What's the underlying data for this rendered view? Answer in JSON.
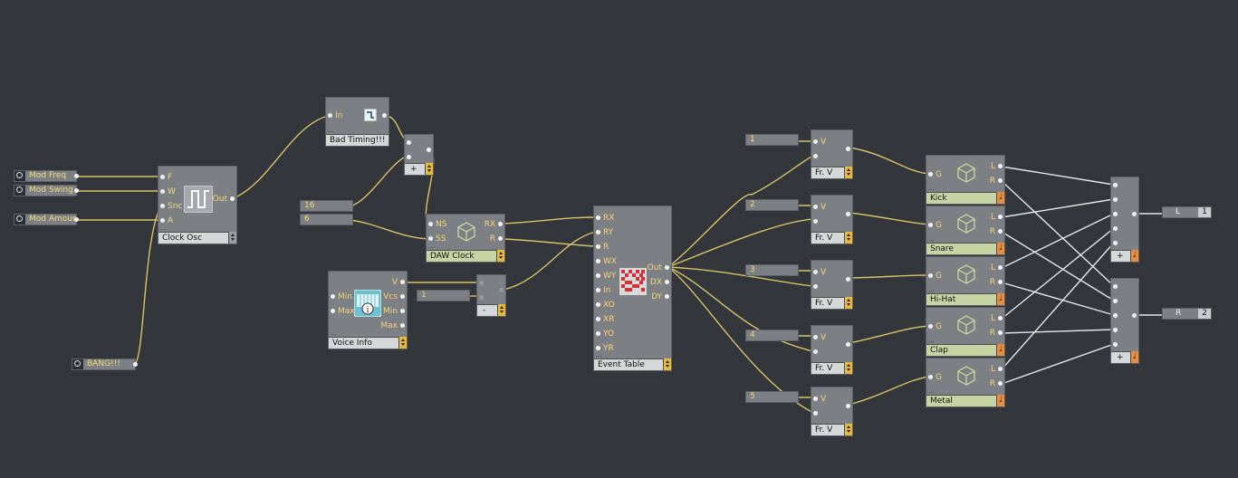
{
  "knobs": [
    {
      "label": "Mod Freq"
    },
    {
      "label": "Mod Swing"
    },
    {
      "label": "Mod Amount"
    }
  ],
  "bang": {
    "label": "BANG!!!"
  },
  "clock_osc": {
    "title": "Clock Osc",
    "in": [
      "F",
      "W",
      "Snc",
      "A"
    ],
    "out": "Out"
  },
  "bad_timing": {
    "title": "Bad Timing!!!",
    "in": "In"
  },
  "adder_top": {
    "title": "+"
  },
  "const_16": "16",
  "const_6": "6",
  "daw_clock": {
    "title": "DAW Clock",
    "in": [
      "NS",
      "SS"
    ],
    "out": [
      "RX",
      "R"
    ]
  },
  "voice_info": {
    "title": "Voice Info",
    "in": [
      "Min",
      "Max"
    ],
    "out": [
      "V",
      "Vcs",
      "Min",
      "Max"
    ]
  },
  "const_1": "1",
  "sub": {
    "title": "-"
  },
  "event_table": {
    "title": "Event Table",
    "in": [
      "RX",
      "RY",
      "R",
      "WX",
      "WY",
      "In",
      "XO",
      "XR",
      "YO",
      "YR"
    ],
    "out": [
      "Out",
      "DX",
      "DY"
    ]
  },
  "frac_consts": [
    "1",
    "2",
    "3",
    "4",
    "5"
  ],
  "frac_title": "Fr. V",
  "frac_in": "V",
  "samplers": [
    {
      "title": "Kick"
    },
    {
      "title": "Snare"
    },
    {
      "title": "Hi-Hat"
    },
    {
      "title": "Clap"
    },
    {
      "title": "Metal"
    }
  ],
  "sampler_in": "G",
  "sampler_out": [
    "L",
    "R"
  ],
  "mix": {
    "title": "+"
  },
  "outputs": [
    {
      "label": "L",
      "num": "1"
    },
    {
      "label": "R",
      "num": "2"
    }
  ],
  "colors": {
    "background": "#33373c",
    "module": "#7c8084",
    "wire": "#d8c26a",
    "port_label": "#f0d877"
  }
}
